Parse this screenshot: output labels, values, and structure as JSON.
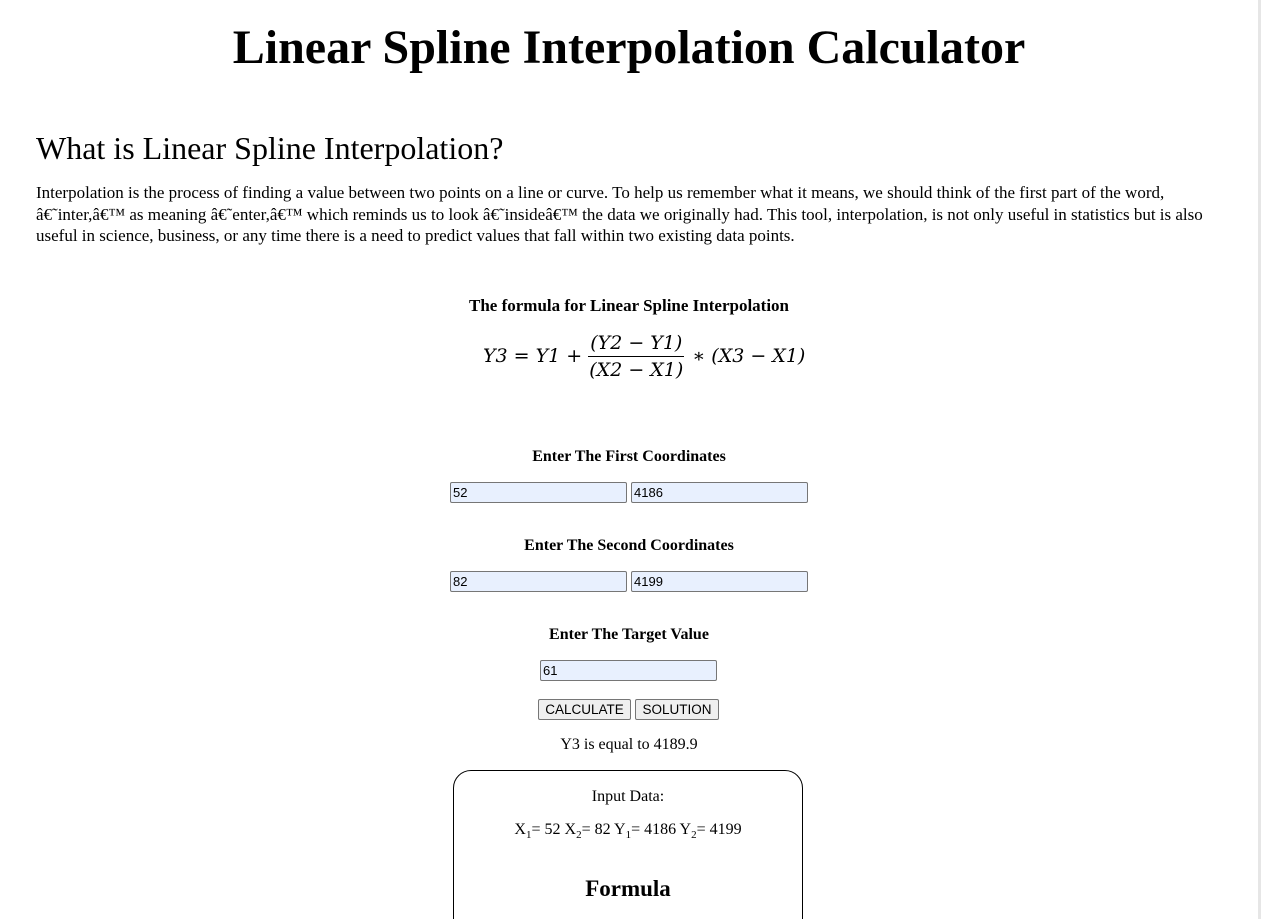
{
  "page": {
    "title": "Linear Spline Interpolation Calculator"
  },
  "intro": {
    "heading": "What is Linear Spline Interpolation?",
    "paragraph": "Interpolation is the process of finding a value between two points on a line or curve. To help us remember what it means, we should think of the first part of the word, â€˜inter,â€™ as meaning â€˜enter,â€™ which reminds us to look â€˜insideâ€™ the data we originally had. This tool, interpolation, is not only useful in statistics but is also useful in science, business, or any time there is a need to predict values that fall within two existing data points."
  },
  "formula": {
    "title": "The formula for Linear Spline Interpolation",
    "lhs": "Y3 = Y1 +",
    "numerator": "(Y2 − Y1)",
    "denominator": "(X2 − X1)",
    "rhs": "∗ (X3 − X1)"
  },
  "inputs": {
    "first_label": "Enter The First Coordinates",
    "x1": "52",
    "y1": "4186",
    "second_label": "Enter The Second Coordinates",
    "x2": "82",
    "y2": "4199",
    "target_label": "Enter The Target Value",
    "x3": "61"
  },
  "buttons": {
    "calculate": "CALCULATE",
    "solution": "SOLUTION"
  },
  "result": {
    "text": "Y3 is equal to 4189.9"
  },
  "solution": {
    "input_heading": "Input Data:",
    "x1_label": "X",
    "x1_sub": "1",
    "x1_value": "= 52",
    "x2_label": "X",
    "x2_sub": "2",
    "x2_value": "= 82",
    "y1_label": "Y",
    "y1_sub": "1",
    "y1_value": "= 4186",
    "y2_label": "Y",
    "y2_sub": "2",
    "y2_value": "= 4199",
    "formula_heading": "Formula"
  },
  "colors": {
    "input_background": "#e8f0fe",
    "button_background": "#efefef"
  }
}
